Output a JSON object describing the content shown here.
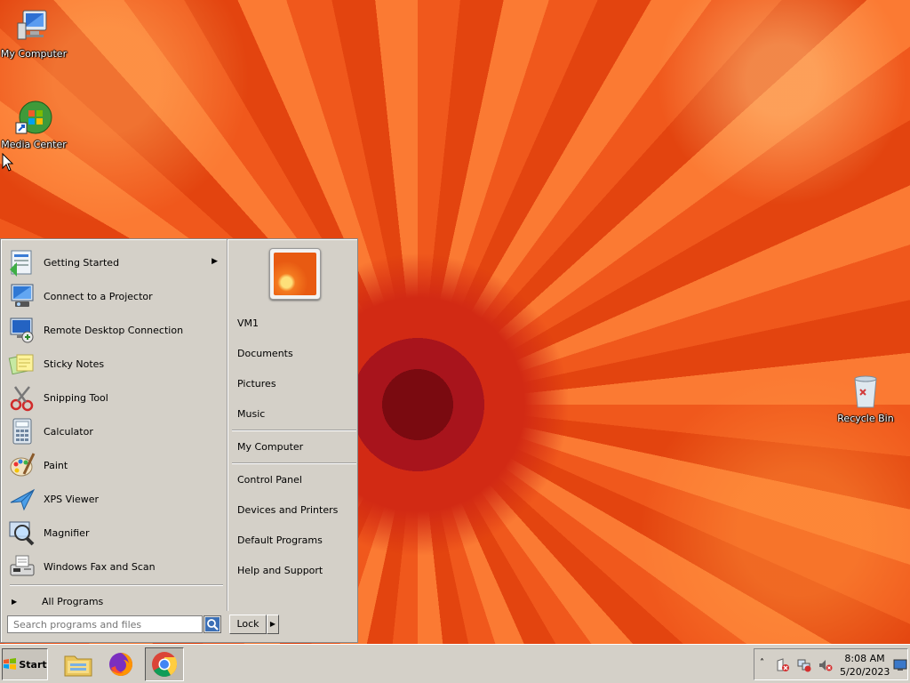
{
  "desktop": {
    "icons": [
      {
        "label": "My Computer"
      },
      {
        "label": "Media Center"
      },
      {
        "label": "Recycle Bin"
      }
    ]
  },
  "start_menu": {
    "programs": [
      {
        "label": "Getting Started",
        "icon": "getting-started-icon",
        "has_submenu": true
      },
      {
        "label": "Connect to a Projector",
        "icon": "projector-icon"
      },
      {
        "label": "Remote Desktop Connection",
        "icon": "remote-desktop-icon"
      },
      {
        "label": "Sticky Notes",
        "icon": "sticky-notes-icon"
      },
      {
        "label": "Snipping Tool",
        "icon": "scissors-icon"
      },
      {
        "label": "Calculator",
        "icon": "calculator-icon"
      },
      {
        "label": "Paint",
        "icon": "paint-palette-icon"
      },
      {
        "label": "XPS Viewer",
        "icon": "xps-viewer-icon"
      },
      {
        "label": "Magnifier",
        "icon": "magnifier-icon"
      },
      {
        "label": "Windows Fax and Scan",
        "icon": "fax-icon"
      }
    ],
    "all_programs": "All Programs",
    "places": {
      "user": "VM1",
      "documents": "Documents",
      "pictures": "Pictures",
      "music": "Music",
      "computer": "My Computer",
      "control_panel": "Control Panel",
      "devices": "Devices and Printers",
      "defaults": "Default Programs",
      "help": "Help and Support"
    },
    "search_placeholder": "Search programs and files",
    "lock_label": "Lock"
  },
  "taskbar": {
    "start_label": "Start",
    "apps": [
      "file-explorer-icon",
      "firefox-icon",
      "chrome-icon"
    ],
    "clock_time": "8:08 AM",
    "clock_date": "5/20/2023"
  }
}
